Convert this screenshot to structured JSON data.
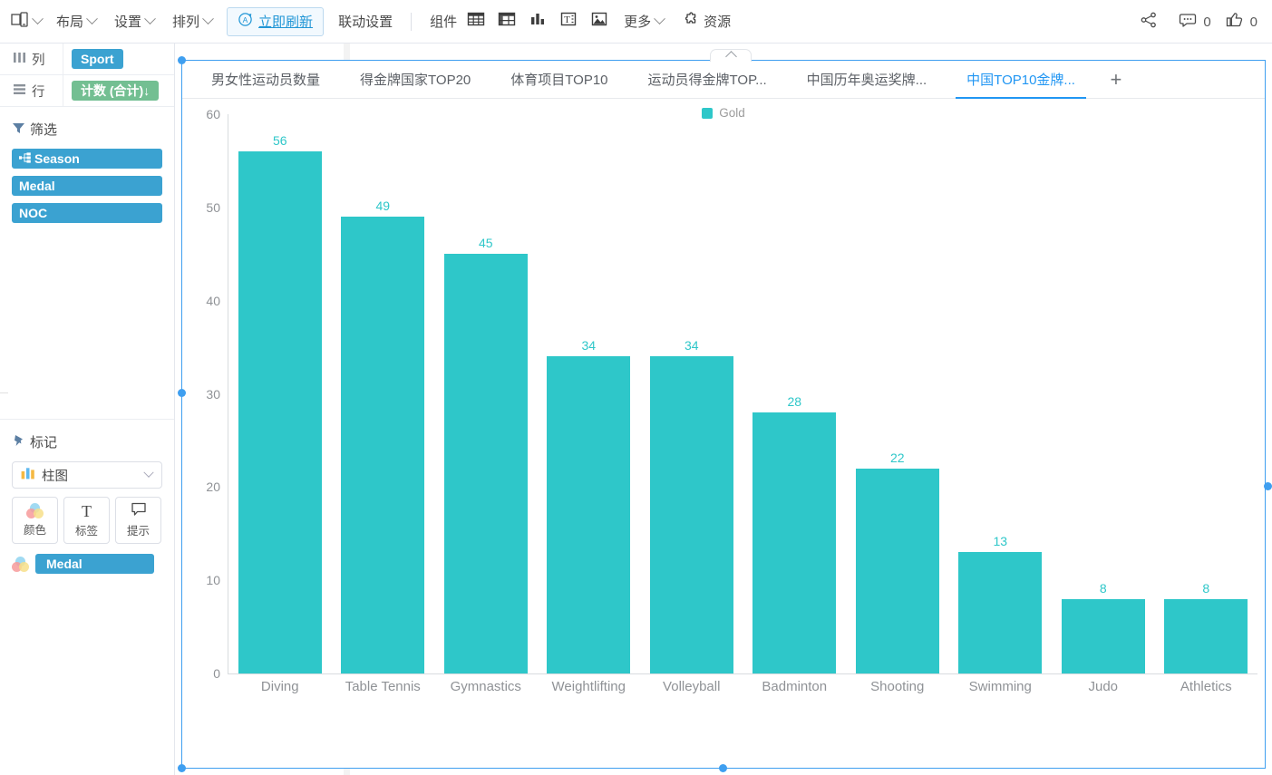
{
  "toolbar": {
    "device_icon": "device-icon",
    "menus": [
      {
        "label": "布局",
        "name": "layout"
      },
      {
        "label": "设置",
        "name": "settings"
      },
      {
        "label": "排列",
        "name": "arrange"
      }
    ],
    "refresh_label": "立即刷新",
    "refresh_icon": "refresh-circle-a-icon",
    "link_settings_label": "联动设置",
    "component_label": "组件",
    "component_icons": [
      "table-grid-icon",
      "pivot-table-icon",
      "bar-chart-icon",
      "text-box-icon",
      "image-icon"
    ],
    "more_label": "更多",
    "resource_label": "资源",
    "resource_icon": "puzzle-icon",
    "share_icon": "share-icon",
    "comment_icon": "comment-icon",
    "comment_count": "0",
    "like_icon": "thumbs-up-icon",
    "like_count": "0"
  },
  "sidebar": {
    "columns_label": "列",
    "columns_icon": "columns-icon",
    "column_pill": "Sport",
    "rows_label": "行",
    "rows_icon": "rows-icon",
    "row_pill": "计数 (合计)↓",
    "filters_title": "筛选",
    "filters_icon": "filter-icon",
    "filters": [
      {
        "label": "Season",
        "icon": "hierarchy-icon"
      },
      {
        "label": "Medal",
        "icon": ""
      },
      {
        "label": "NOC",
        "icon": ""
      }
    ],
    "marks_title": "标记",
    "marks_icon": "pin-icon",
    "mark_type": "柱图",
    "mark_type_icon": "bar-chart-icon",
    "mark_buttons": [
      {
        "label": "颜色",
        "icon": "color-venn-icon"
      },
      {
        "label": "标签",
        "icon": "text-t-icon"
      },
      {
        "label": "提示",
        "icon": "tooltip-icon"
      }
    ],
    "color_field": "Medal",
    "color_field_icon": "color-venn-icon"
  },
  "tabs": {
    "items": [
      {
        "label": "男女性运动员数量",
        "active": false
      },
      {
        "label": "得金牌国家TOP20",
        "active": false
      },
      {
        "label": "体育项目TOP10",
        "active": false
      },
      {
        "label": "运动员得金牌TOP...",
        "active": false
      },
      {
        "label": "中国历年奥运奖牌...",
        "active": false
      },
      {
        "label": "中国TOP10金牌...",
        "active": true
      }
    ],
    "add_label": "+"
  },
  "colors": {
    "bar": "#2ec7c9",
    "accent_blue": "#2196f3",
    "pill_blue": "#3ba2d1",
    "pill_green": "#73bf92"
  },
  "chart_data": {
    "type": "bar",
    "title": "",
    "xlabel": "",
    "ylabel": "",
    "categories": [
      "Diving",
      "Table Tennis",
      "Gymnastics",
      "Weightlifting",
      "Volleyball",
      "Badminton",
      "Shooting",
      "Swimming",
      "Judo",
      "Athletics"
    ],
    "values": [
      56,
      49,
      45,
      34,
      34,
      28,
      22,
      13,
      8,
      8
    ],
    "series": [
      {
        "name": "Gold",
        "values": [
          56,
          49,
          45,
          34,
          34,
          28,
          22,
          13,
          8,
          8
        ],
        "color": "#2ec7c9"
      }
    ],
    "legend": [
      "Gold"
    ],
    "legend_position": "top-center",
    "yticks": [
      60,
      50,
      40,
      30,
      20,
      10,
      0
    ],
    "ylim": [
      0,
      60
    ],
    "grid": false,
    "data_labels": true
  }
}
